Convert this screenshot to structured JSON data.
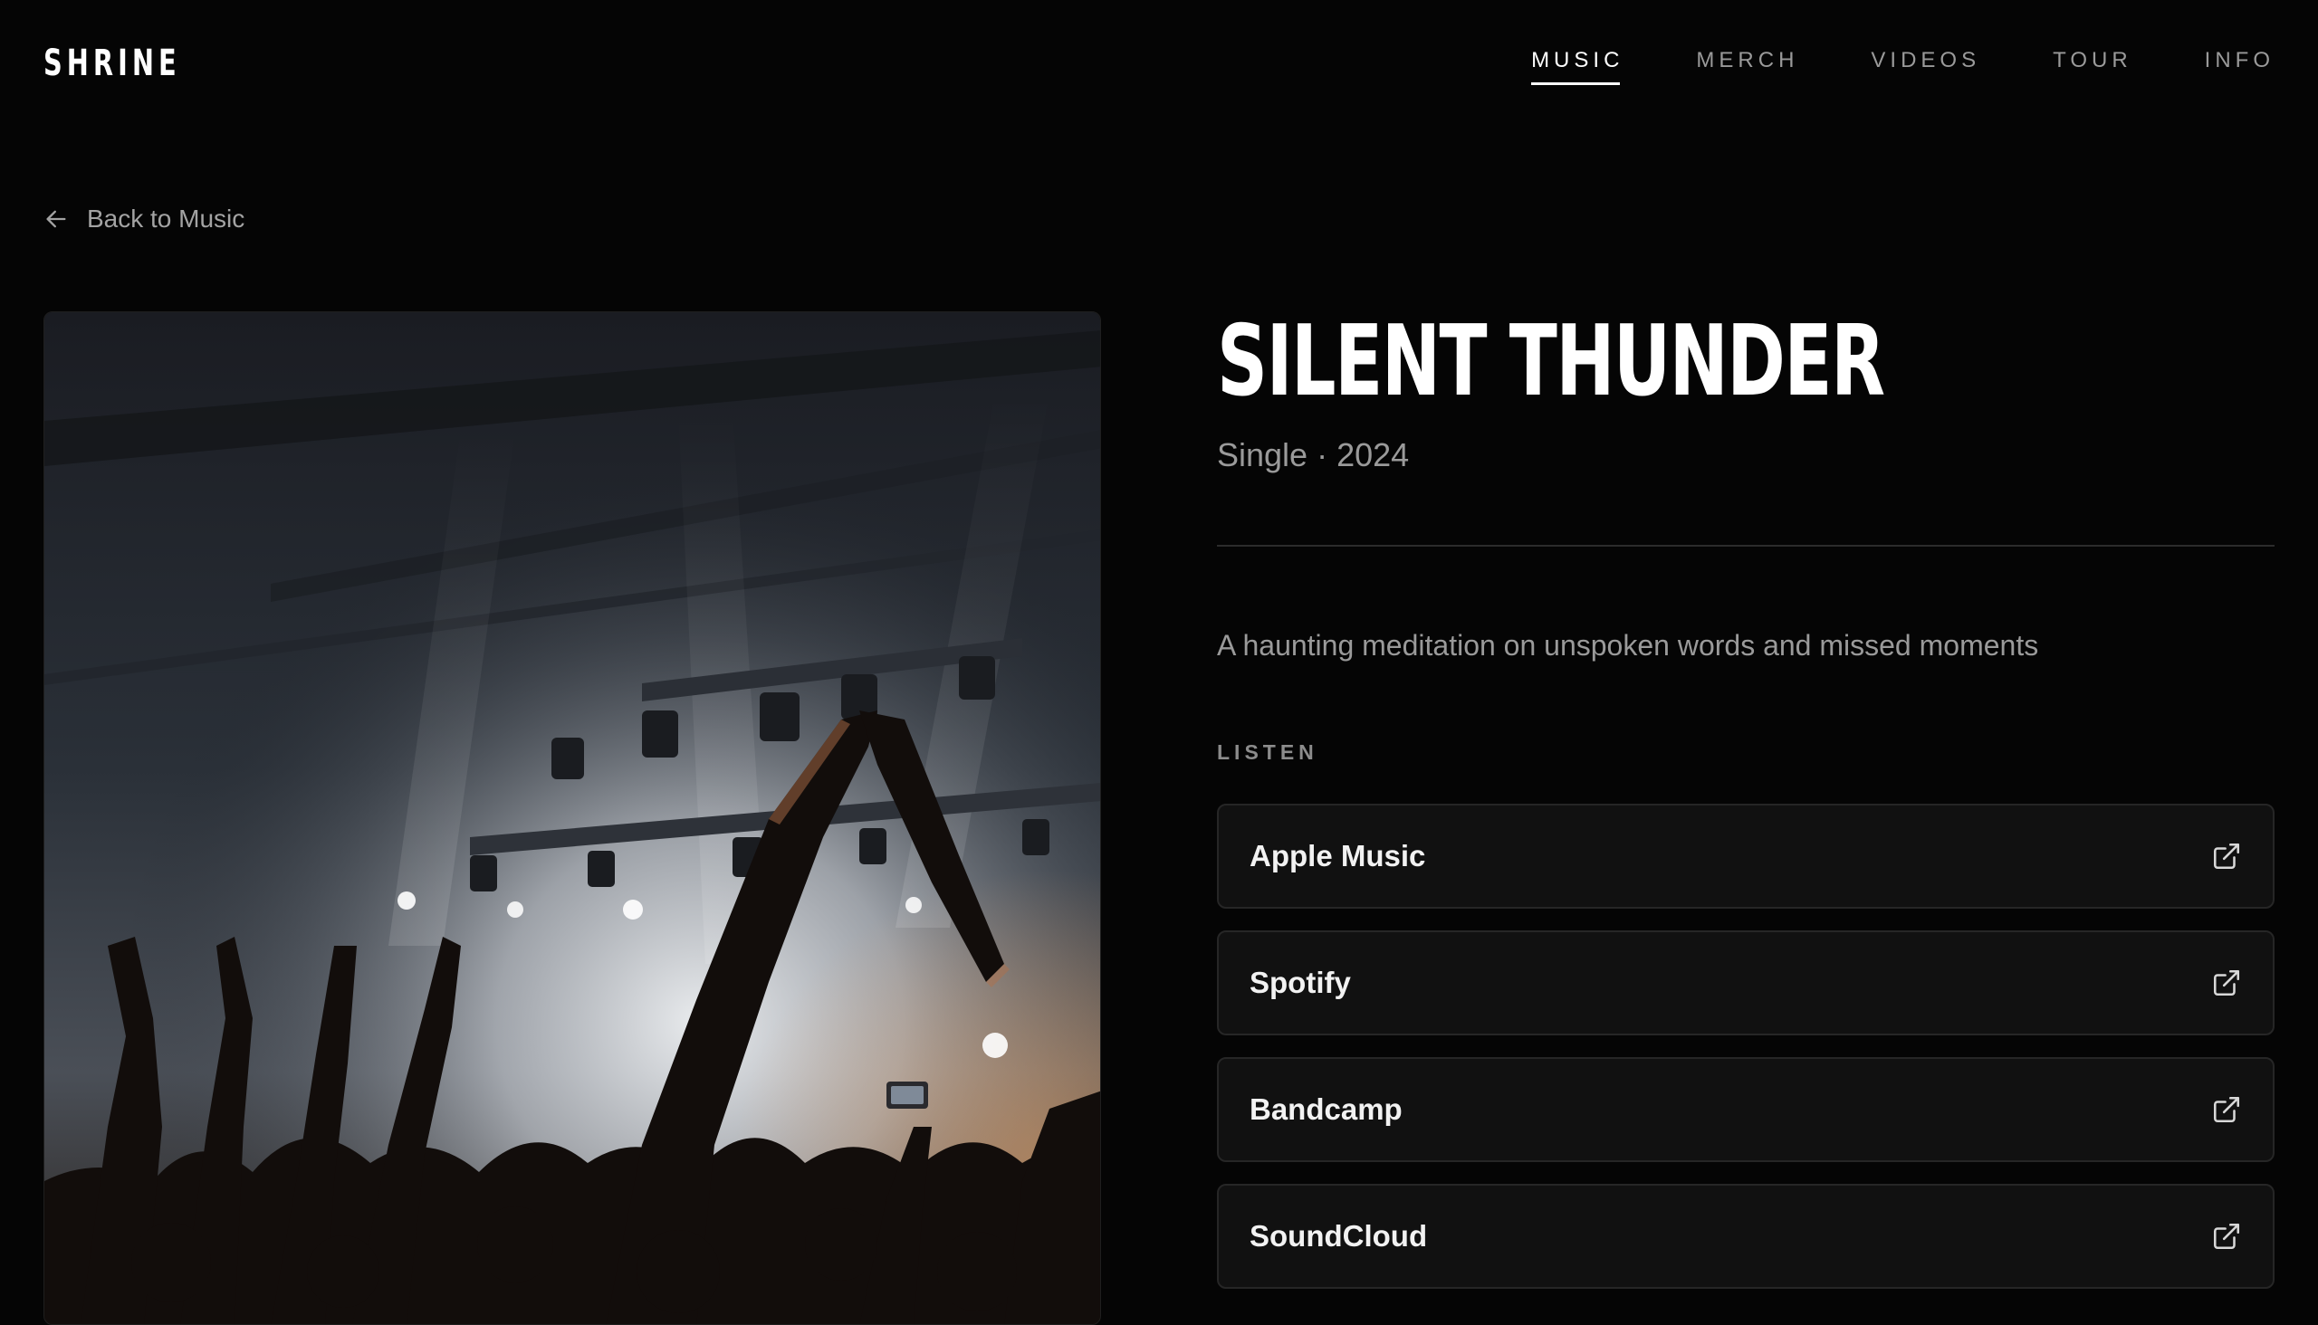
{
  "brand": {
    "logo": "SHRINE"
  },
  "nav": {
    "items": [
      {
        "label": "MUSIC",
        "active": true
      },
      {
        "label": "MERCH",
        "active": false
      },
      {
        "label": "VIDEOS",
        "active": false
      },
      {
        "label": "TOUR",
        "active": false
      },
      {
        "label": "INFO",
        "active": false
      }
    ]
  },
  "back_link": {
    "label": "Back to Music",
    "icon": "arrow-left-icon"
  },
  "cover": {
    "alt": "Concert crowd with raised hands in front of a stage light"
  },
  "release": {
    "title": "SILENT THUNDER",
    "meta": "Single · 2024",
    "description": "A haunting meditation on unspoken words and missed moments"
  },
  "listen": {
    "label": "LISTEN",
    "platforms": [
      {
        "name": "Apple Music",
        "icon": "external-link-icon"
      },
      {
        "name": "Spotify",
        "icon": "external-link-icon"
      },
      {
        "name": "Bandcamp",
        "icon": "external-link-icon"
      },
      {
        "name": "SoundCloud",
        "icon": "external-link-icon"
      }
    ]
  },
  "colors": {
    "background": "#050505",
    "text_primary": "#ffffff",
    "text_muted": "#9a9a9a",
    "card_bg": "#111111",
    "card_border": "#262626"
  }
}
